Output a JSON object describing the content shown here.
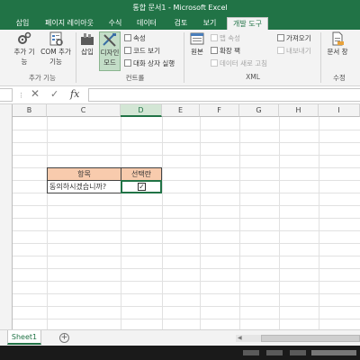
{
  "window": {
    "title": "통합 문서1 - Microsoft Excel"
  },
  "tabs": [
    {
      "label": "삽입"
    },
    {
      "label": "페이지 레이아웃"
    },
    {
      "label": "수식"
    },
    {
      "label": "데이터"
    },
    {
      "label": "검토"
    },
    {
      "label": "보기"
    },
    {
      "label": "개발 도구",
      "active": true
    }
  ],
  "ribbon": {
    "addins": {
      "addin_btn": "추가 기능",
      "com_addin_btn": "COM 추가 기능",
      "group_label": "추가 기능"
    },
    "controls": {
      "insert_btn": "삽입",
      "design_mode_btn": "디자인 모드",
      "properties": "속성",
      "view_code": "코드 보기",
      "run_dialog": "대화 상자 실행",
      "group_label": "컨트롤"
    },
    "xml": {
      "source_btn": "원본",
      "map_properties": "맵 속성",
      "expansion_packs": "확장 팩",
      "refresh_data": "데이터 새로 고침",
      "import": "가져오기",
      "export": "내보내기",
      "group_label": "XML"
    },
    "modify": {
      "document_panel_btn": "문서 창",
      "group_label": "수정"
    }
  },
  "formula_bar": {
    "fx_label": "fx",
    "value": ""
  },
  "columns": [
    "B",
    "C",
    "D",
    "E",
    "F",
    "G",
    "H",
    "I"
  ],
  "selected_column": "D",
  "table": {
    "header_item": "항목",
    "header_select": "선택란",
    "row_item": "동의하시겠습니까?",
    "row_checked": true
  },
  "sheets": [
    {
      "name": "Sheet1",
      "active": true
    }
  ],
  "colors": {
    "accent": "#217346",
    "header_fill": "#f8cbad"
  }
}
